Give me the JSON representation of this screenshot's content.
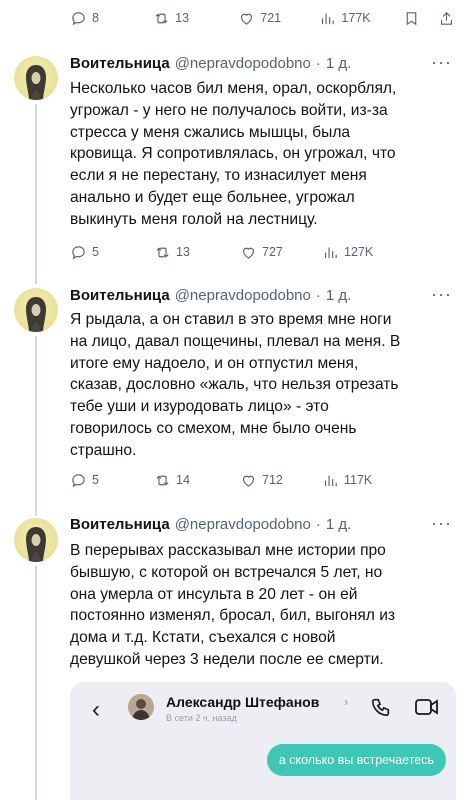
{
  "top_actions": {
    "replies": "8",
    "retweets": "13",
    "likes": "721",
    "views": "177K"
  },
  "tweets": [
    {
      "name": "Воительница",
      "handle": "@nepravdopodobno",
      "dot": "·",
      "date": "1 д.",
      "more": "···",
      "lines": [
        "Несколько часов бил меня, орал, оскорблял,",
        "угрожал - у него не получалось войти, из-за",
        "стресса у меня сжались мышцы, была",
        "кровища. Я сопротивлялась, он угрожал, что",
        "если я не перестану, то изнасилует меня",
        "анально и будет еще больнее, угрожал",
        "выкинуть меня голой на лестницу."
      ],
      "replies": "5",
      "retweets": "13",
      "likes": "727",
      "views": "127K"
    },
    {
      "name": "Воительница",
      "handle": "@nepravdopodobno",
      "dot": "·",
      "date": "1 д.",
      "more": "···",
      "lines": [
        "Я рыдала, а он ставил в это время мне ноги",
        "на лицо, давал пощечины, плевал на меня. В",
        "итоге ему надоело, и он отпустил меня,",
        "сказав, дословно «жаль, что нельзя отрезать",
        "тебе уши и изуродовать лицо» - это",
        "говорилось со смехом, мне было очень",
        "страшно."
      ],
      "replies": "5",
      "retweets": "14",
      "likes": "712",
      "views": "117K"
    },
    {
      "name": "Воительница",
      "handle": "@nepravdopodobno",
      "dot": "·",
      "date": "1 д.",
      "more": "···",
      "lines": [
        "В перерывах рассказывал мне  истории про",
        "бывшую, с которой он встречался 5 лет, но",
        "она умерла от инсульта в 20 лет - он ей",
        "постоянно изменял, бросал, бил, выгонял из",
        "дома и т.д. Кстати, съехался с новой",
        "девушкой через 3 недели после ее смерти."
      ]
    }
  ],
  "embed": {
    "back": "‹",
    "contact_name": "Александр Штефанов",
    "chevron": "›",
    "status": "В сети 2 ч. назад",
    "message": "а сколько вы встречаетесь",
    "bubble_color": "#3ec7b5"
  },
  "icons": [
    "reply-icon",
    "retweet-icon",
    "like-icon",
    "views-icon",
    "bookmark-icon",
    "share-icon",
    "back-icon",
    "phone-icon",
    "video-icon"
  ],
  "colors": {
    "text": "#0f1419",
    "secondary": "#536471",
    "thread_line": "#cfd9de"
  }
}
